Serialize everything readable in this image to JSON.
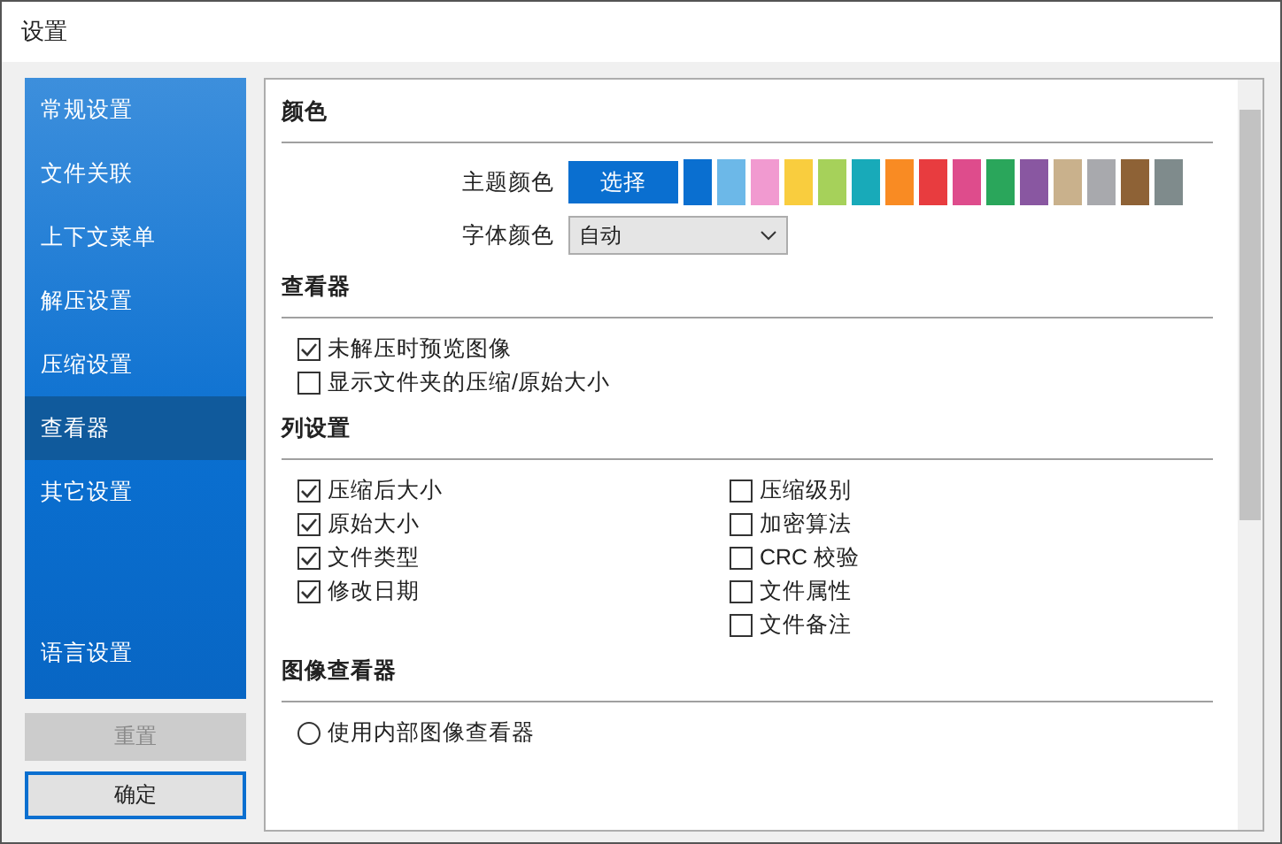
{
  "window": {
    "title": "设置"
  },
  "sidebar": {
    "items": [
      {
        "label": "常规设置",
        "selected": false
      },
      {
        "label": "文件关联",
        "selected": false
      },
      {
        "label": "上下文菜单",
        "selected": false
      },
      {
        "label": "解压设置",
        "selected": false
      },
      {
        "label": "压缩设置",
        "selected": false
      },
      {
        "label": "查看器",
        "selected": true
      },
      {
        "label": "其它设置",
        "selected": false
      }
    ],
    "bottom_item": {
      "label": "语言设置",
      "selected": false
    }
  },
  "buttons": [
    {
      "label": "重置",
      "disabled": true
    },
    {
      "label": "确定",
      "disabled": false
    }
  ],
  "sections": [
    {
      "title": "颜色",
      "kind": "colors",
      "theme_label": "主题颜色",
      "choose_button": "选择",
      "swatches": [
        {
          "color": "#0a6fd0"
        },
        {
          "color": "#6cb8e8"
        },
        {
          "color": "#f19ad0"
        },
        {
          "color": "#f9cd3e"
        },
        {
          "color": "#a6d15a"
        },
        {
          "color": "#18aab9"
        },
        {
          "color": "#f98b23"
        },
        {
          "color": "#e83c3f"
        },
        {
          "color": "#de4c8c"
        },
        {
          "color": "#2aa65b"
        },
        {
          "color": "#8957a1"
        },
        {
          "color": "#c9b18c"
        },
        {
          "color": "#a8a9ad"
        },
        {
          "color": "#8e6236"
        },
        {
          "color": "#7f8b8c"
        }
      ],
      "font_label": "字体颜色",
      "font_value": "自动"
    },
    {
      "title": "查看器",
      "kind": "checks",
      "columns": [
        [
          {
            "label": "未解压时预览图像",
            "checked": true
          },
          {
            "label": "显示文件夹的压缩/原始大小",
            "checked": false
          }
        ]
      ]
    },
    {
      "title": "列设置",
      "kind": "checks",
      "columns": [
        [
          {
            "label": "压缩后大小",
            "checked": true
          },
          {
            "label": "原始大小",
            "checked": true
          },
          {
            "label": "文件类型",
            "checked": true
          },
          {
            "label": "修改日期",
            "checked": true
          }
        ],
        [
          {
            "label": "压缩级别",
            "checked": false
          },
          {
            "label": "加密算法",
            "checked": false
          },
          {
            "label": "CRC 校验",
            "checked": false
          },
          {
            "label": "文件属性",
            "checked": false
          },
          {
            "label": "文件备注",
            "checked": false
          }
        ]
      ]
    },
    {
      "title": "图像查看器",
      "kind": "radios",
      "options": [
        {
          "label": "使用内部图像查看器",
          "selected": false
        }
      ]
    }
  ]
}
